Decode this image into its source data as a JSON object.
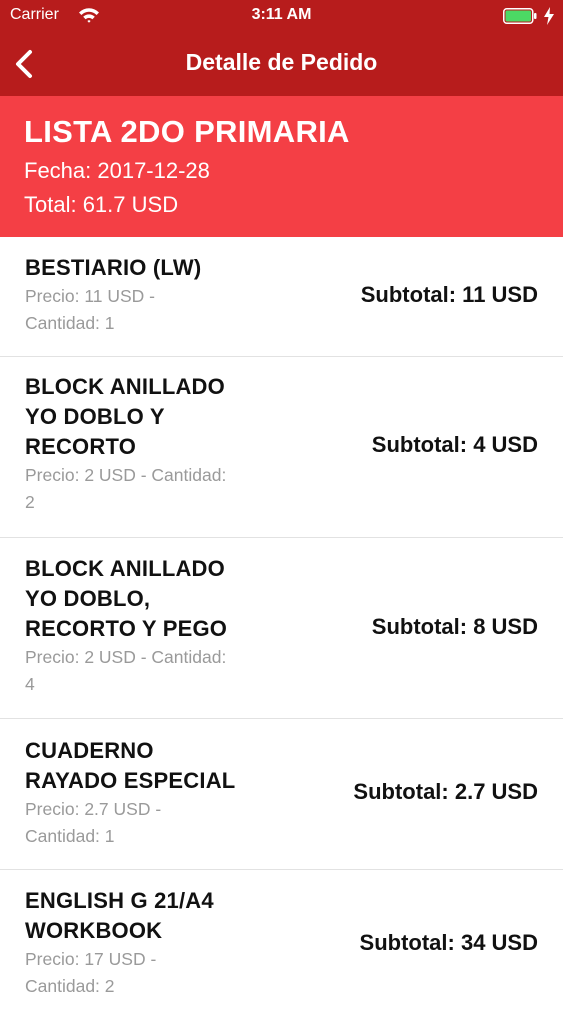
{
  "status_bar": {
    "carrier": "Carrier",
    "time": "3:11 AM"
  },
  "nav": {
    "title": "Detalle de Pedido"
  },
  "order": {
    "title": "LISTA 2DO PRIMARIA",
    "date": "Fecha: 2017-12-28",
    "total": "Total: 61.7 USD"
  },
  "items": [
    {
      "name_lines": [
        "BESTIARIO (LW)"
      ],
      "detail_lines": [
        "Precio: 11 USD -",
        "Cantidad: 1"
      ],
      "subtotal": "Subtotal: 11 USD"
    },
    {
      "name_lines": [
        "BLOCK ANILLADO",
        "YO DOBLO Y",
        "RECORTO"
      ],
      "detail_lines": [
        "Precio: 2 USD - Cantidad:",
        "2"
      ],
      "subtotal": "Subtotal: 4 USD"
    },
    {
      "name_lines": [
        "BLOCK ANILLADO",
        "YO DOBLO,",
        "RECORTO Y PEGO"
      ],
      "detail_lines": [
        "Precio: 2 USD - Cantidad:",
        "4"
      ],
      "subtotal": "Subtotal: 8 USD"
    },
    {
      "name_lines": [
        "CUADERNO",
        "RAYADO ESPECIAL"
      ],
      "detail_lines": [
        "Precio: 2.7 USD -",
        "Cantidad: 1"
      ],
      "subtotal": "Subtotal: 2.7 USD"
    },
    {
      "name_lines": [
        "ENGLISH G 21/A4",
        "WORKBOOK"
      ],
      "detail_lines": [
        "Precio: 17 USD -",
        "Cantidad: 2"
      ],
      "subtotal": "Subtotal: 34 USD"
    }
  ],
  "colors": {
    "nav_background": "#b71c1c",
    "header_background": "#f43f45",
    "detail_text": "#9a9a9a",
    "battery_fill": "#4cd964"
  },
  "icons": {
    "back": "chevron-left-icon",
    "wifi": "wifi-icon",
    "battery": "battery-icon",
    "charging": "charging-bolt-icon"
  }
}
